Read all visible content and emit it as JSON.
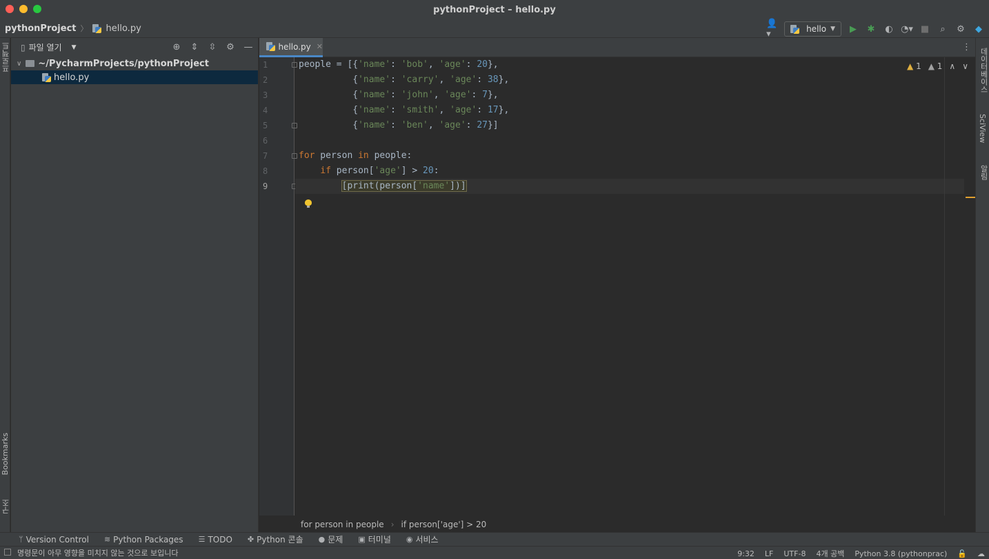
{
  "window": {
    "title": "pythonProject – hello.py"
  },
  "navbar": {
    "project": "pythonProject",
    "file": "hello.py",
    "run_config": "hello"
  },
  "left_strip": {
    "project_label": "프로젝트",
    "bookmarks_label": "Bookmarks",
    "structure_label": "구조"
  },
  "project_panel": {
    "view_label": "파일 열기",
    "root": "~/PycharmProjects/pythonProject",
    "files": [
      "hello.py"
    ]
  },
  "editor": {
    "tab": "hello.py",
    "warnings": {
      "weak": "1",
      "typo": "1"
    },
    "current_line": 9,
    "line_numbers": [
      "1",
      "2",
      "3",
      "4",
      "5",
      "6",
      "7",
      "8",
      "9"
    ],
    "breadcrumb": [
      "for person in people",
      "if person['age'] > 20"
    ]
  },
  "right_strip": {
    "database_label": "데이터베이스",
    "sciview_label": "SciView",
    "notifications_label": "알림"
  },
  "tool_windows": [
    "Version Control",
    "Python Packages",
    "TODO",
    "Python 콘솔",
    "문제",
    "터미널",
    "서비스"
  ],
  "status": {
    "message": "명령문이 아무 영향을 미치지 않는 것으로 보입니다",
    "position": "9:32",
    "line_sep": "LF",
    "encoding": "UTF-8",
    "indent": "4개 공백",
    "interpreter": "Python 3.8 (pythonprac)"
  },
  "colors": {
    "keyword": "#cc7832",
    "string": "#6a8759",
    "number": "#6897bb",
    "text": "#a9b7c6",
    "selection": "#0d293e",
    "accent": "#4a88c7"
  }
}
